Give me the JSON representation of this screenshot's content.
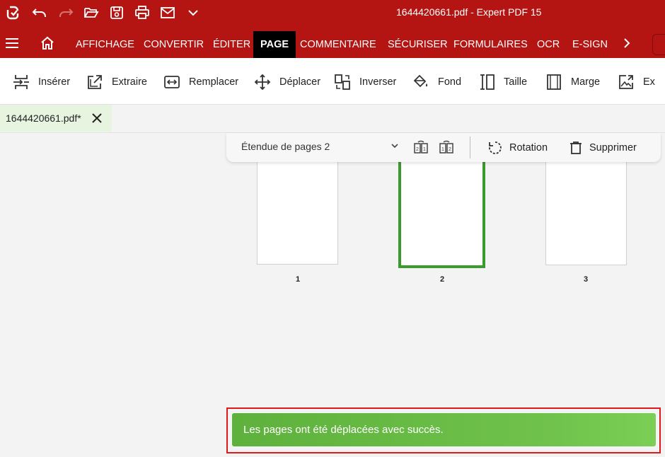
{
  "window": {
    "title": "1644420661.pdf   -   Expert PDF 15"
  },
  "quick_access": [
    "app-logo-icon",
    "undo-icon",
    "redo-icon",
    "open-folder-icon",
    "save-icon",
    "print-icon",
    "mail-icon",
    "customize-chevron-icon"
  ],
  "ribbon": {
    "tabs": [
      {
        "key": "affichage",
        "label": "AFFICHAGE"
      },
      {
        "key": "convertir",
        "label": "CONVERTIR"
      },
      {
        "key": "editer",
        "label": "ÉDITER"
      },
      {
        "key": "page",
        "label": "PAGE",
        "active": true
      },
      {
        "key": "commentaire",
        "label": "COMMENTAIRE"
      },
      {
        "key": "securiser",
        "label": "SÉCURISER"
      },
      {
        "key": "formulaires",
        "label": "FORMULAIRES"
      },
      {
        "key": "ocr",
        "label": "OCR"
      },
      {
        "key": "esign",
        "label": "E-SIGN"
      }
    ]
  },
  "toolbar": {
    "items": [
      {
        "label": "Insérer",
        "icon": "insert-icon"
      },
      {
        "label": "Extraire",
        "icon": "extract-icon"
      },
      {
        "label": "Remplacer",
        "icon": "replace-icon"
      },
      {
        "label": "Déplacer",
        "icon": "move-icon"
      },
      {
        "label": "Inverser",
        "icon": "reverse-icon"
      },
      {
        "label": "Fond",
        "icon": "fill-bucket-icon"
      },
      {
        "label": "Taille",
        "icon": "size-icon"
      },
      {
        "label": "Marge",
        "icon": "margin-icon"
      },
      {
        "label": "Ex",
        "icon": "export-image-icon"
      }
    ]
  },
  "document_tab": {
    "name": "1644420661.pdf*"
  },
  "page_toolbar": {
    "range_label": "Étendue de pages 2",
    "rotate_label": "Rotation",
    "delete_label": "Supprimer"
  },
  "pages": [
    {
      "number": "1",
      "selected": false
    },
    {
      "number": "2",
      "selected": true
    },
    {
      "number": "3",
      "selected": false
    }
  ],
  "toast": {
    "message": "Les pages ont été déplacées avec succès."
  },
  "colors": {
    "brand_red": "#b51512",
    "active_tab": "#000000",
    "selection_green": "#3b9a2d",
    "toast_green": "#6fc24b",
    "highlight_red": "#e0191c"
  }
}
